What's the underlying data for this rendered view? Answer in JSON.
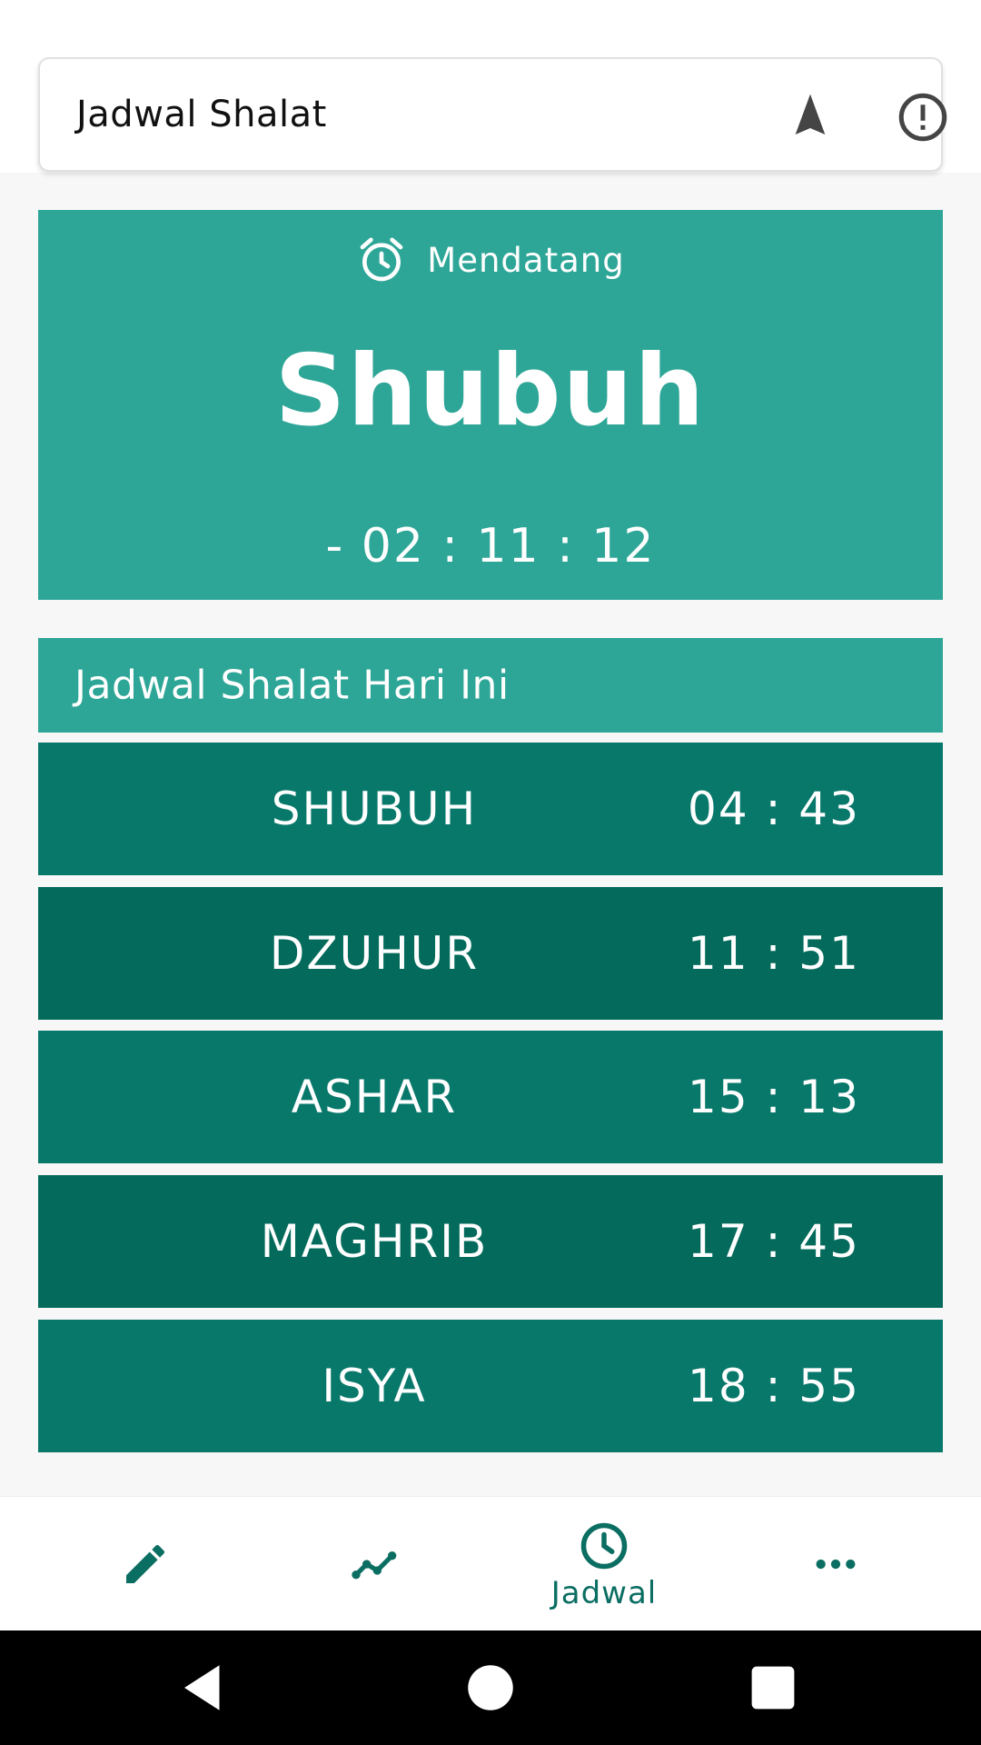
{
  "app_bar": {
    "title": "Jadwal Shalat",
    "icons": [
      "navigation-arrow-icon",
      "info-alert-icon"
    ]
  },
  "upcoming": {
    "label": "Mendatang",
    "icon": "alarm-clock-icon",
    "prayer": "Shubuh",
    "countdown": "- 02 : 11 : 12"
  },
  "schedule": {
    "title": "Jadwal Shalat Hari Ini",
    "rows": [
      {
        "name": "SHUBUH",
        "time": "04 : 43"
      },
      {
        "name": "DZUHUR",
        "time": "11 : 51"
      },
      {
        "name": "ASHAR",
        "time": "15 : 13"
      },
      {
        "name": "MAGHRIB",
        "time": "17 : 45"
      },
      {
        "name": "ISYA",
        "time": "18 : 55"
      }
    ]
  },
  "bottom_nav": {
    "items": [
      {
        "icon": "pencil-icon",
        "label": ""
      },
      {
        "icon": "chart-line-icon",
        "label": ""
      },
      {
        "icon": "clock-icon",
        "label": "Jadwal",
        "active": true
      },
      {
        "icon": "more-horizontal-icon",
        "label": ""
      }
    ]
  },
  "colors": {
    "accent": "#2ea697",
    "row_dark_a": "#08786b",
    "row_dark_b": "#046b5c",
    "nav_active": "#0b6e62"
  }
}
